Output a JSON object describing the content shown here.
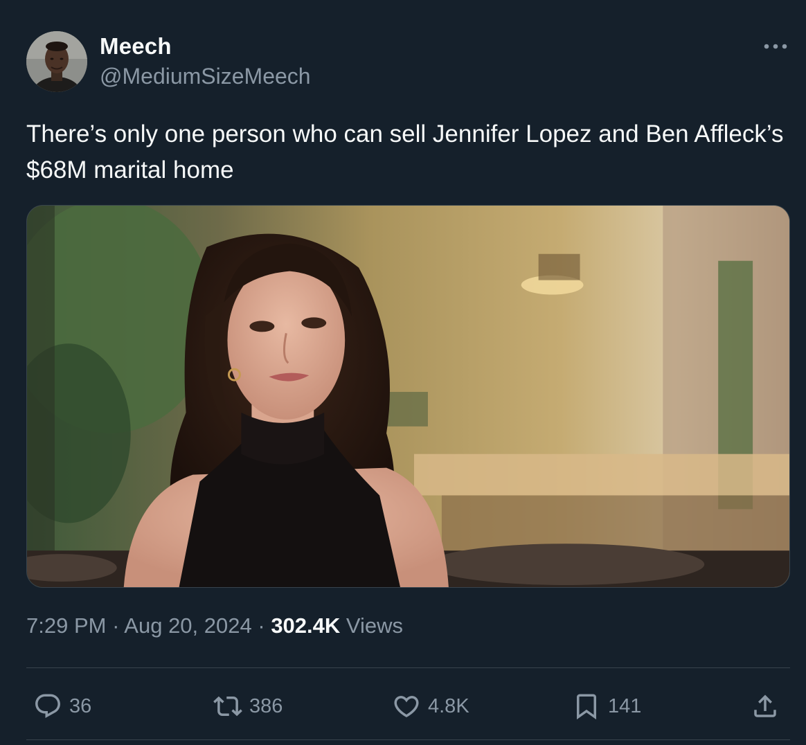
{
  "author": {
    "name": "Meech",
    "handle": "@MediumSizeMeech"
  },
  "tweet": {
    "text": "There’s only one person who can sell Jennifer Lopez and Ben Affleck’s $68M marital home"
  },
  "meta": {
    "time": "7:29 PM",
    "separator1": " · ",
    "date": "Aug 20, 2024",
    "separator2": " · ",
    "views_count": "302.4K",
    "views_label": " Views"
  },
  "actions": {
    "replies": "36",
    "reposts": "386",
    "likes": "4.8K",
    "bookmarks": "141"
  },
  "icons": {
    "more": "more-icon",
    "reply": "reply-icon",
    "repost": "repost-icon",
    "like": "heart-icon",
    "bookmark": "bookmark-icon",
    "share": "share-icon"
  },
  "colors": {
    "background": "#15202b",
    "primary_text": "#f7f9f9",
    "secondary_text": "#8b98a5",
    "divider": "#38444d"
  }
}
